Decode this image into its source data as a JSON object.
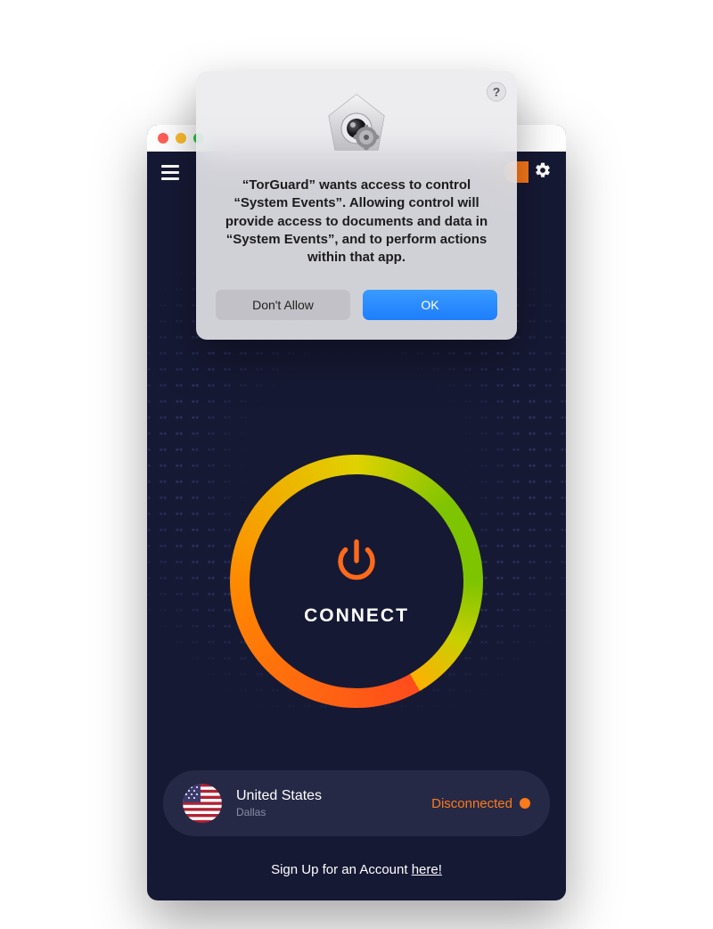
{
  "dialog": {
    "help_char": "?",
    "message": "“TorGuard” wants access to control “System Events”. Allowing control will provide access to documents and data in “System Events”, and to perform actions within that app.",
    "deny_label": "Don't Allow",
    "ok_label": "OK"
  },
  "main": {
    "connect_label": "CONNECT"
  },
  "location": {
    "country": "United States",
    "city": "Dallas",
    "status_text": "Disconnected"
  },
  "footer": {
    "signup_prefix": "Sign Up for an Account ",
    "signup_link": "here!"
  }
}
